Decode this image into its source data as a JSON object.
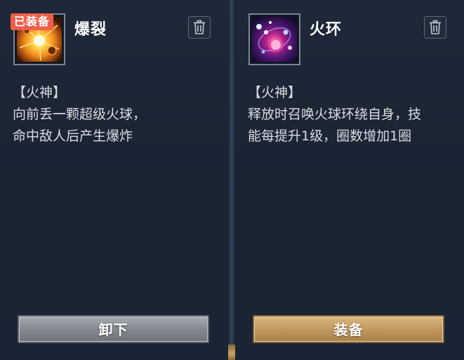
{
  "cards": [
    {
      "badge": "已装备",
      "name": "爆裂",
      "icon": "fire-burst-skill-icon",
      "desc_lines": [
        "【火神】",
        "向前丢一颗超级火球，",
        "命中敌人后产生爆炸"
      ],
      "button": "卸下"
    },
    {
      "name": "火环",
      "icon": "fire-ring-skill-icon",
      "desc_lines": [
        "【火神】",
        "释放时召唤火球环绕自身，技",
        "能每提升1级，圈数增加1圈"
      ],
      "button": "装备"
    }
  ],
  "colors": {
    "badge": "#ef5e4b",
    "unequip_button": "#878b92",
    "equip_button": "#c49c61",
    "panel_bg": "#1b2533"
  }
}
